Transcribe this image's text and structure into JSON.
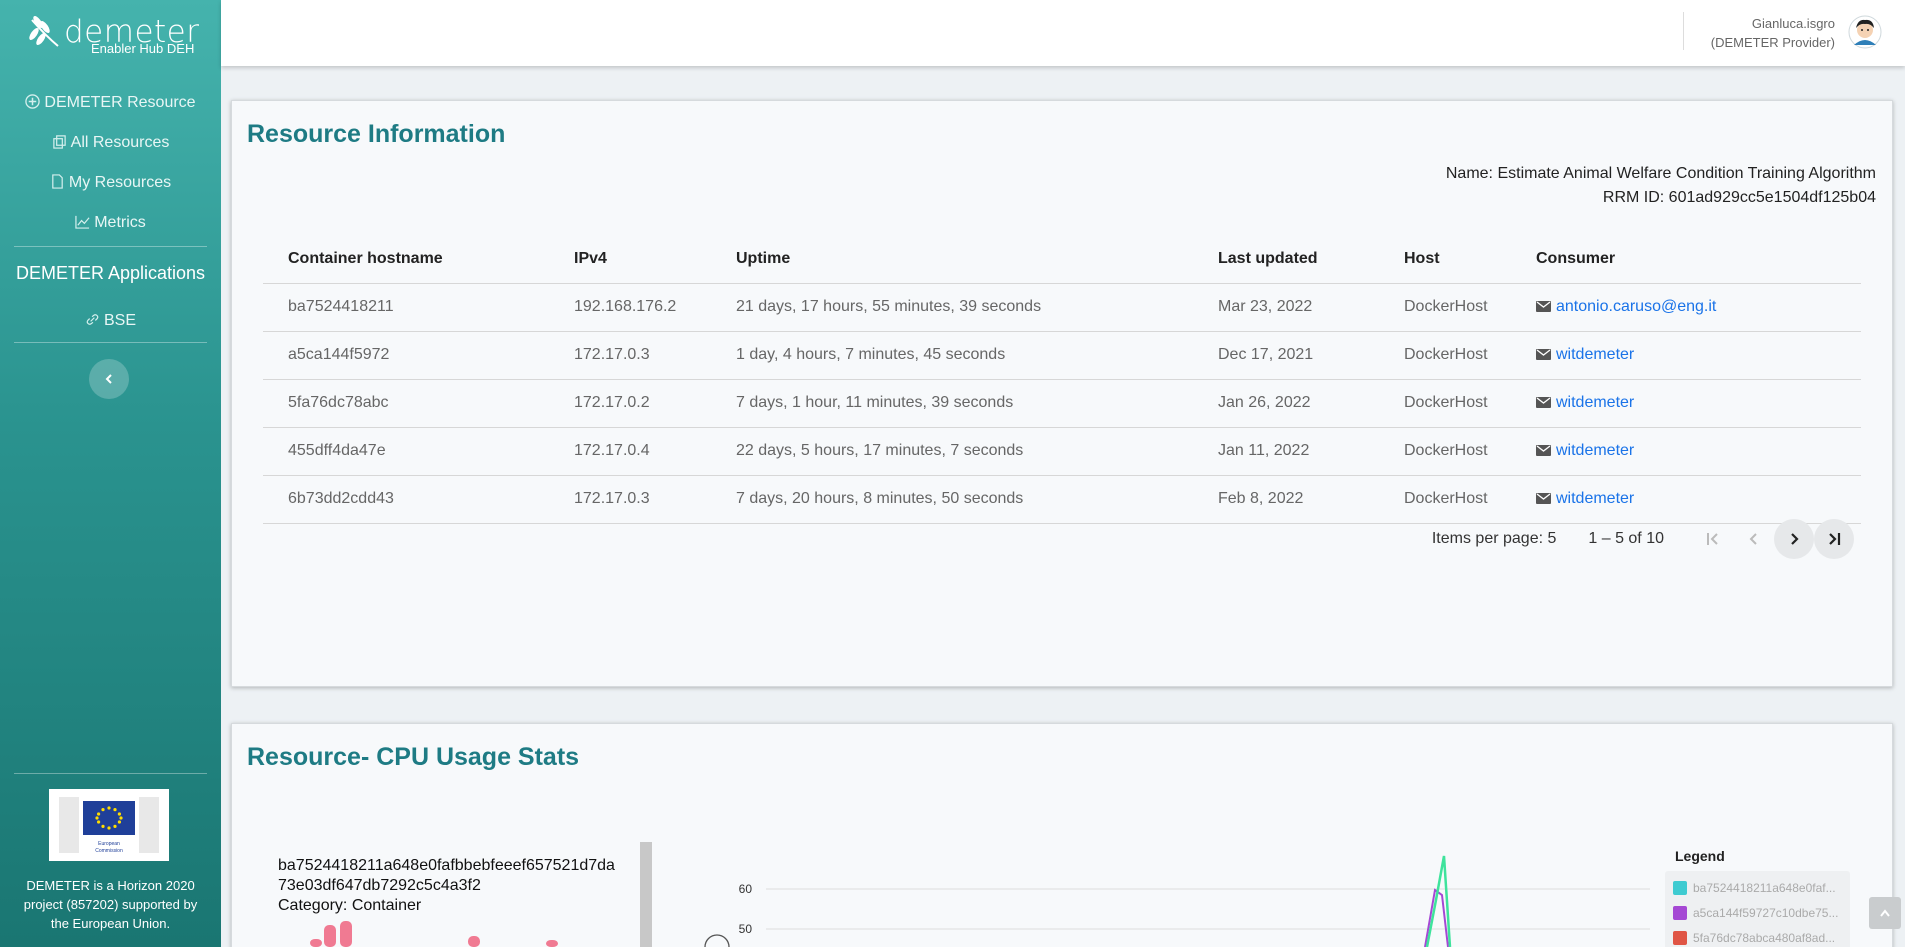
{
  "brand": {
    "word": "demeter",
    "sub": "Enabler Hub DEH"
  },
  "sidebar": {
    "items": [
      {
        "label": "DEMETER Resource",
        "icon": "plus-circle-icon"
      },
      {
        "label": "All Resources",
        "icon": "copy-icon"
      },
      {
        "label": "My Resources",
        "icon": "file-icon"
      },
      {
        "label": "Metrics",
        "icon": "line-chart-icon"
      }
    ],
    "section": "DEMETER Applications",
    "apps": [
      {
        "label": "BSE",
        "icon": "link-icon"
      }
    ],
    "eu_text": "DEMETER is a Horizon 2020 project (857202) supported by the European Union.",
    "eu_logo_caption": "European Commission"
  },
  "user": {
    "name": "Gianluca.isgro",
    "role": "(DEMETER Provider)"
  },
  "resource_info": {
    "title": "Resource Information",
    "name_line": "Name: Estimate Animal Welfare Condition Training Algorithm",
    "rrm_line": "RRM ID: 601ad929cc5e1504df125b04",
    "columns": [
      "Container hostname",
      "IPv4",
      "Uptime",
      "Last updated",
      "Host",
      "Consumer"
    ],
    "rows": [
      [
        "ba7524418211",
        "192.168.176.2",
        "21 days, 17 hours, 55 minutes, 39 seconds",
        "Mar 23, 2022",
        "DockerHost",
        "antonio.caruso@eng.it"
      ],
      [
        "a5ca144f5972",
        "172.17.0.3",
        "1 day, 4 hours, 7 minutes, 45 seconds",
        "Dec 17, 2021",
        "DockerHost",
        "witdemeter"
      ],
      [
        "5fa76dc78abc",
        "172.17.0.2",
        "7 days, 1 hour, 11 minutes, 39 seconds",
        "Jan 26, 2022",
        "DockerHost",
        "witdemeter"
      ],
      [
        "455dff4da47e",
        "172.17.0.4",
        "22 days, 5 hours, 17 minutes, 7 seconds",
        "Jan 11, 2022",
        "DockerHost",
        "witdemeter"
      ],
      [
        "6b73dd2cdd43",
        "172.17.0.3",
        "7 days, 20 hours, 8 minutes, 50 seconds",
        "Feb 8, 2022",
        "DockerHost",
        "witdemeter"
      ]
    ],
    "pager": {
      "items_per_page": "Items per page: 5",
      "range": "1 – 5 of 10"
    }
  },
  "cpu_stats": {
    "title": "Resource- CPU Usage Stats",
    "tooltip_label": "ba7524418211a648e0fafbbebfeeef657521d7da73e03df647db7292c5c4a3f2",
    "tooltip_category": "Category: Container",
    "y_ticks": [
      "60",
      "50"
    ],
    "legend_title": "Legend",
    "legend": [
      {
        "label": "ba7524418211a648e0faf...",
        "color": "#3ecbd1"
      },
      {
        "label": "a5ca144f59727c10dbe75...",
        "color": "#a548d4"
      },
      {
        "label": "5fa76dc78abca480af8ad...",
        "color": "#e05545"
      }
    ]
  },
  "colors": {
    "accent": "#1e7b84",
    "link": "#1a73e8"
  }
}
